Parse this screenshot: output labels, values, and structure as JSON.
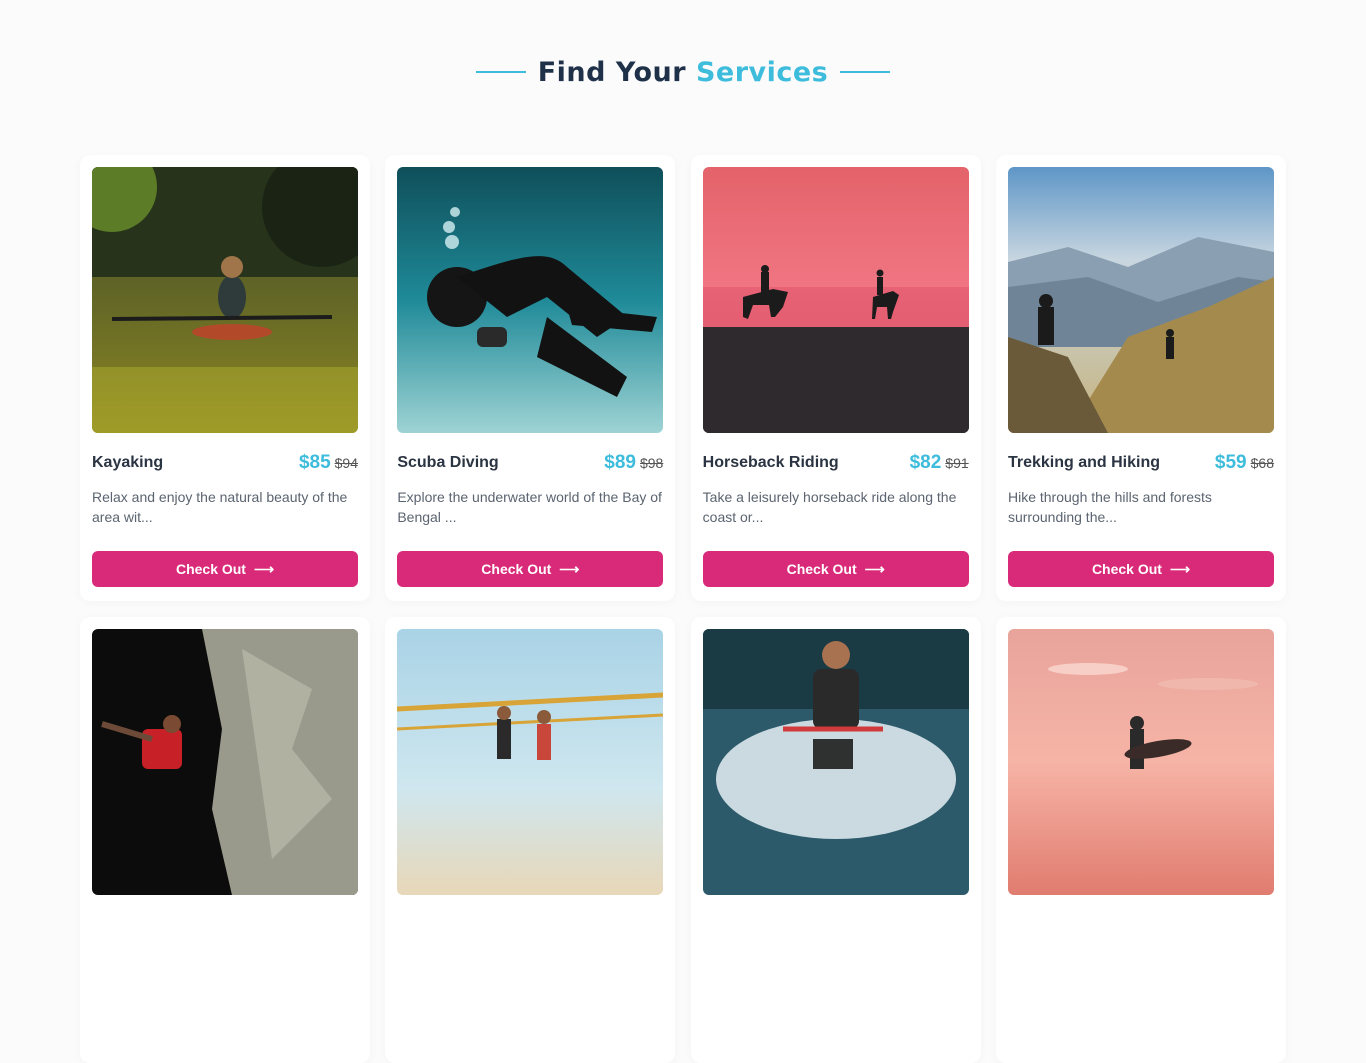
{
  "header": {
    "title_part1": "Find Your",
    "title_part2": "Services"
  },
  "colors": {
    "accent": "#3dbcdc",
    "button": "#d92a7a",
    "heading": "#1f3148"
  },
  "cards": [
    {
      "name": "Kayaking",
      "price": "$85",
      "old_price": "$94",
      "description": "Relax and enjoy the natural beauty of the area wit...",
      "button": "Check Out",
      "image": "kayaking-photo"
    },
    {
      "name": "Scuba Diving",
      "price": "$89",
      "old_price": "$98",
      "description": "Explore the underwater world of the Bay of Bengal ...",
      "button": "Check Out",
      "image": "scuba-diving-photo"
    },
    {
      "name": "Horseback Riding",
      "price": "$82",
      "old_price": "$91",
      "description": "Take a leisurely horseback ride along the coast or...",
      "button": "Check Out",
      "image": "horseback-riding-photo"
    },
    {
      "name": "Trekking and Hiking",
      "price": "$59",
      "old_price": "$68",
      "description": "Hike through the hills and forests surrounding the...",
      "button": "Check Out",
      "image": "trekking-photo"
    },
    {
      "image": "rock-climbing-photo"
    },
    {
      "image": "beach-volleyball-photo"
    },
    {
      "image": "jet-ski-photo"
    },
    {
      "image": "surfing-photo"
    }
  ],
  "icons": {
    "arrow": "arrow-right-icon"
  }
}
